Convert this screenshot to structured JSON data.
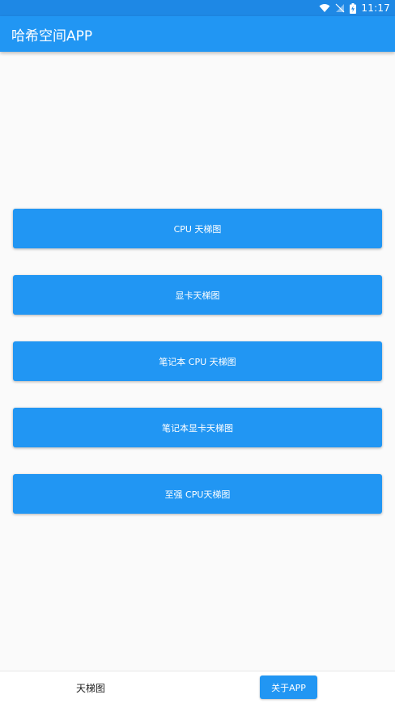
{
  "status_bar": {
    "time": "11:17",
    "icons": [
      "wifi-icon",
      "no-signal-icon",
      "battery-charging-icon"
    ]
  },
  "app_bar": {
    "title": "哈希空间APP"
  },
  "main": {
    "buttons": [
      {
        "label": "CPU 天梯图"
      },
      {
        "label": "显卡天梯图"
      },
      {
        "label": "笔记本 CPU 天梯图"
      },
      {
        "label": "笔记本显卡天梯图"
      },
      {
        "label": "至强 CPU天梯图"
      }
    ]
  },
  "bottom_nav": {
    "tabs": [
      {
        "label": "天梯图",
        "active": false
      },
      {
        "label": "关于APP",
        "active": true
      }
    ]
  },
  "colors": {
    "primary": "#2196f3",
    "status_bar": "#1e88e5",
    "background": "#fafafa"
  }
}
